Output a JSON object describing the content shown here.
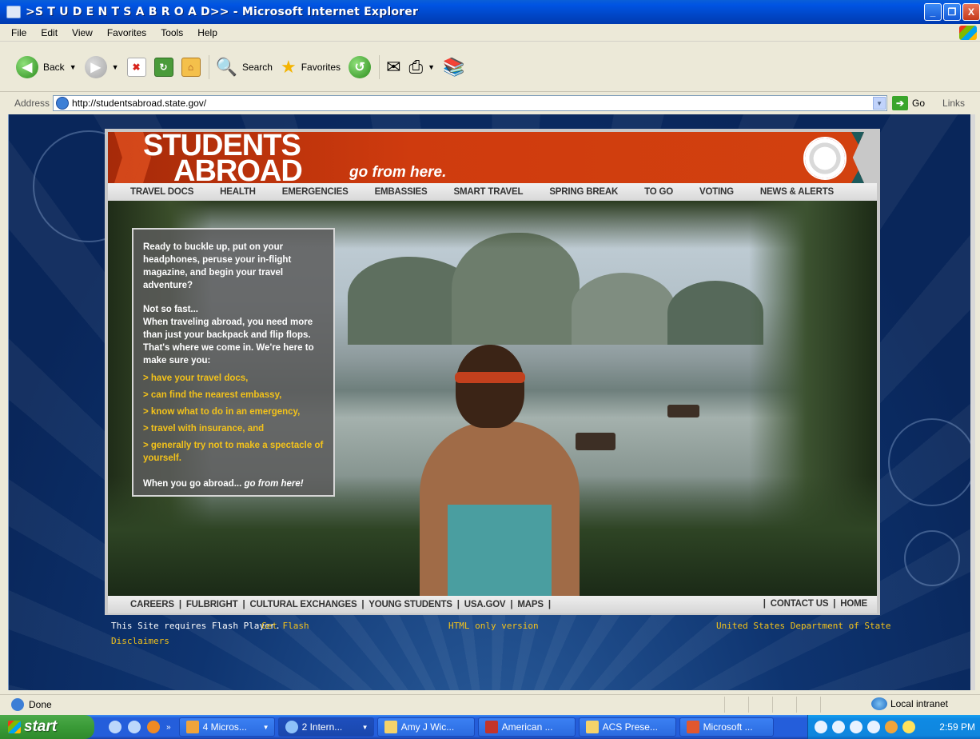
{
  "window": {
    "title": ">S T U D E N T S A B R O A D>> - Microsoft Internet Explorer",
    "controls": [
      "_",
      "❐",
      "X"
    ]
  },
  "menu": [
    "File",
    "Edit",
    "View",
    "Favorites",
    "Tools",
    "Help"
  ],
  "toolbar": {
    "back_label": "Back",
    "search_label": "Search",
    "favorites_label": "Favorites"
  },
  "address": {
    "label": "Address",
    "url": "http://studentsabroad.state.gov/",
    "go_label": "Go",
    "links_label": "Links"
  },
  "site": {
    "logo_line1": "STUDENTS",
    "logo_line2": "ABROAD",
    "tagline": "go from here.",
    "nav": [
      "TRAVEL DOCS",
      "HEALTH",
      "EMERGENCIES",
      "EMBASSIES",
      "SMART TRAVEL",
      "SPRING BREAK",
      "TO GO",
      "VOTING",
      "NEWS & ALERTS"
    ],
    "intro": "Ready to buckle up, put on your headphones, peruse your in-flight magazine, and begin your travel adventure?",
    "not_so_fast": "Not so fast...",
    "body": "When traveling abroad, you need more than just your backpack and flip flops. That's where we come in. We're here to make sure you:",
    "bullets": [
      "> have your travel docs,",
      "> can find the nearest embassy,",
      "> know what to do in an emergency,",
      "> travel with insurance, and",
      "> generally try not to make a spectacle of yourself."
    ],
    "closing_lead": "When you go abroad...",
    "closing_em": "go from here!",
    "footer_left": "CAREERS  |  FULBRIGHT  |  CULTURAL EXCHANGES  |  YOUNG STUDENTS  |  USA.GOV  |  MAPS  |",
    "footer_right": "|  CONTACT US  |  HOME",
    "flash_notice": "This Site requires Flash Player.",
    "get_flash": "Get Flash",
    "disclaimers": "Disclaimers",
    "html_only": "HTML only version",
    "dept": "United States Department of State"
  },
  "status": {
    "text": "Done",
    "zone": "Local intranet"
  },
  "taskbar": {
    "start": "start",
    "tasks": [
      {
        "label": "4 Micros...",
        "icon": "office-icon",
        "caret": true
      },
      {
        "label": "2 Intern...",
        "icon": "ie-icon",
        "caret": true,
        "active": true
      },
      {
        "label": "Amy J Wic...",
        "icon": "chart-icon"
      },
      {
        "label": "American ...",
        "icon": "flag-icon"
      },
      {
        "label": "ACS Prese...",
        "icon": "folder-icon"
      },
      {
        "label": "Microsoft ...",
        "icon": "powerpoint-icon"
      }
    ],
    "clock": "2:59 PM"
  }
}
